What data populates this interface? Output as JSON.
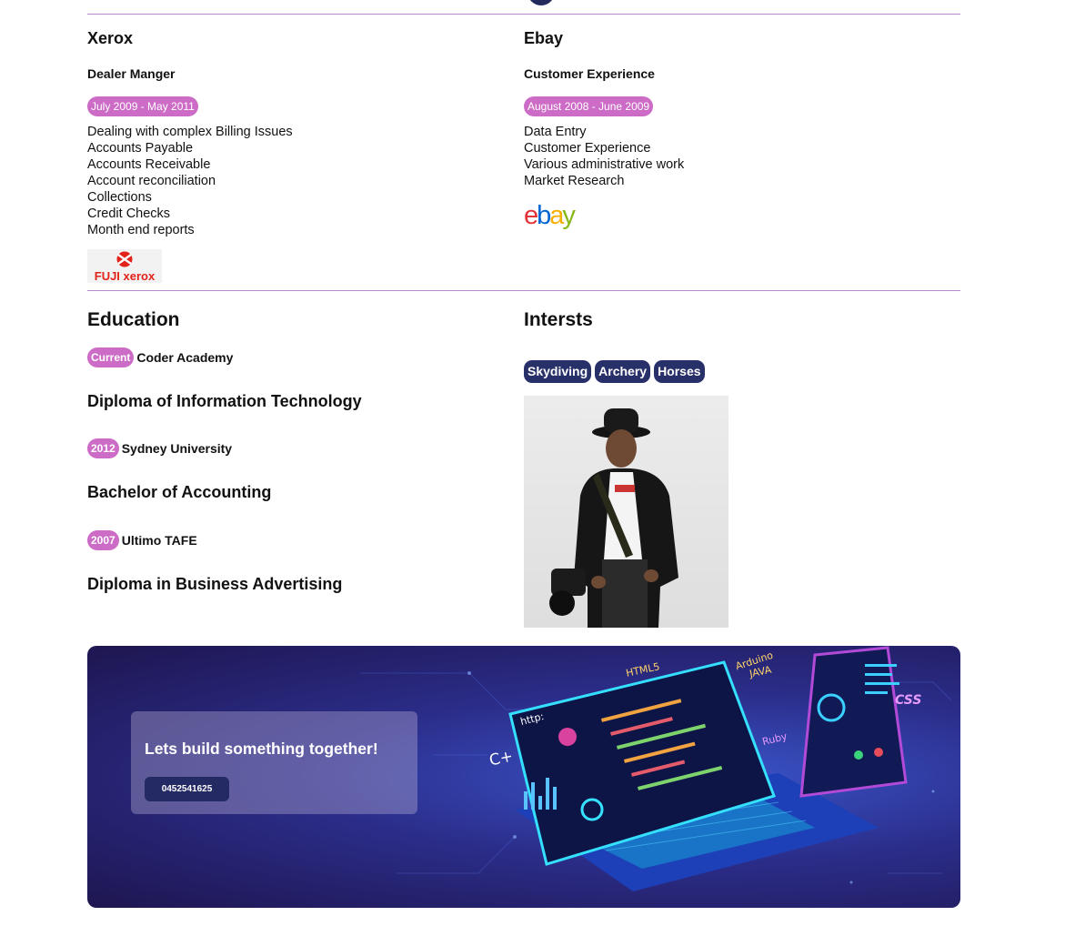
{
  "experience": [
    {
      "company": "Xerox",
      "role": "Dealer Manger",
      "dates": "July 2009 - May 2011",
      "duties": [
        "Dealing with complex Billing Issues",
        "Accounts Payable",
        "Accounts Receivable",
        "Account reconciliation",
        "Collections",
        "Credit Checks",
        "Month end reports"
      ],
      "logo": {
        "brand_text": "FUJI xerox",
        "brand_color": "#e2231a"
      }
    },
    {
      "company": "Ebay",
      "role": "Customer Experience",
      "dates": "August 2008 - June 2009",
      "duties": [
        "Data Entry",
        "Customer Experience",
        "Various administrative work",
        "Market Research"
      ],
      "logo": {
        "letters": [
          "e",
          "b",
          "a",
          "y"
        ],
        "letter_colors": [
          "#e53238",
          "#0064d2",
          "#f5af02",
          "#86b817"
        ]
      }
    }
  ],
  "education": {
    "title": "Education",
    "entries": [
      {
        "badge": "Current",
        "school": "Coder Academy",
        "qualification": "Diploma of Information Technology"
      },
      {
        "badge": "2012",
        "school": "Sydney University",
        "qualification": "Bachelor of Accounting"
      },
      {
        "badge": "2007",
        "school": "Ultimo TAFE",
        "qualification": "Diploma in Business Advertising"
      }
    ]
  },
  "interests": {
    "title": "Intersts",
    "tags": [
      "Skydiving",
      "Archery",
      "Horses"
    ]
  },
  "banner": {
    "headline": "Lets build something together!",
    "phone": "0452541625",
    "decor_words": [
      "HTML5",
      "Arduino",
      "JAVA",
      "http:",
      "C+",
      "Ruby",
      "CSS"
    ]
  },
  "colors": {
    "accent_pink": "#cc6cc6",
    "navy": "#28306a",
    "divider": "#b68acd"
  }
}
